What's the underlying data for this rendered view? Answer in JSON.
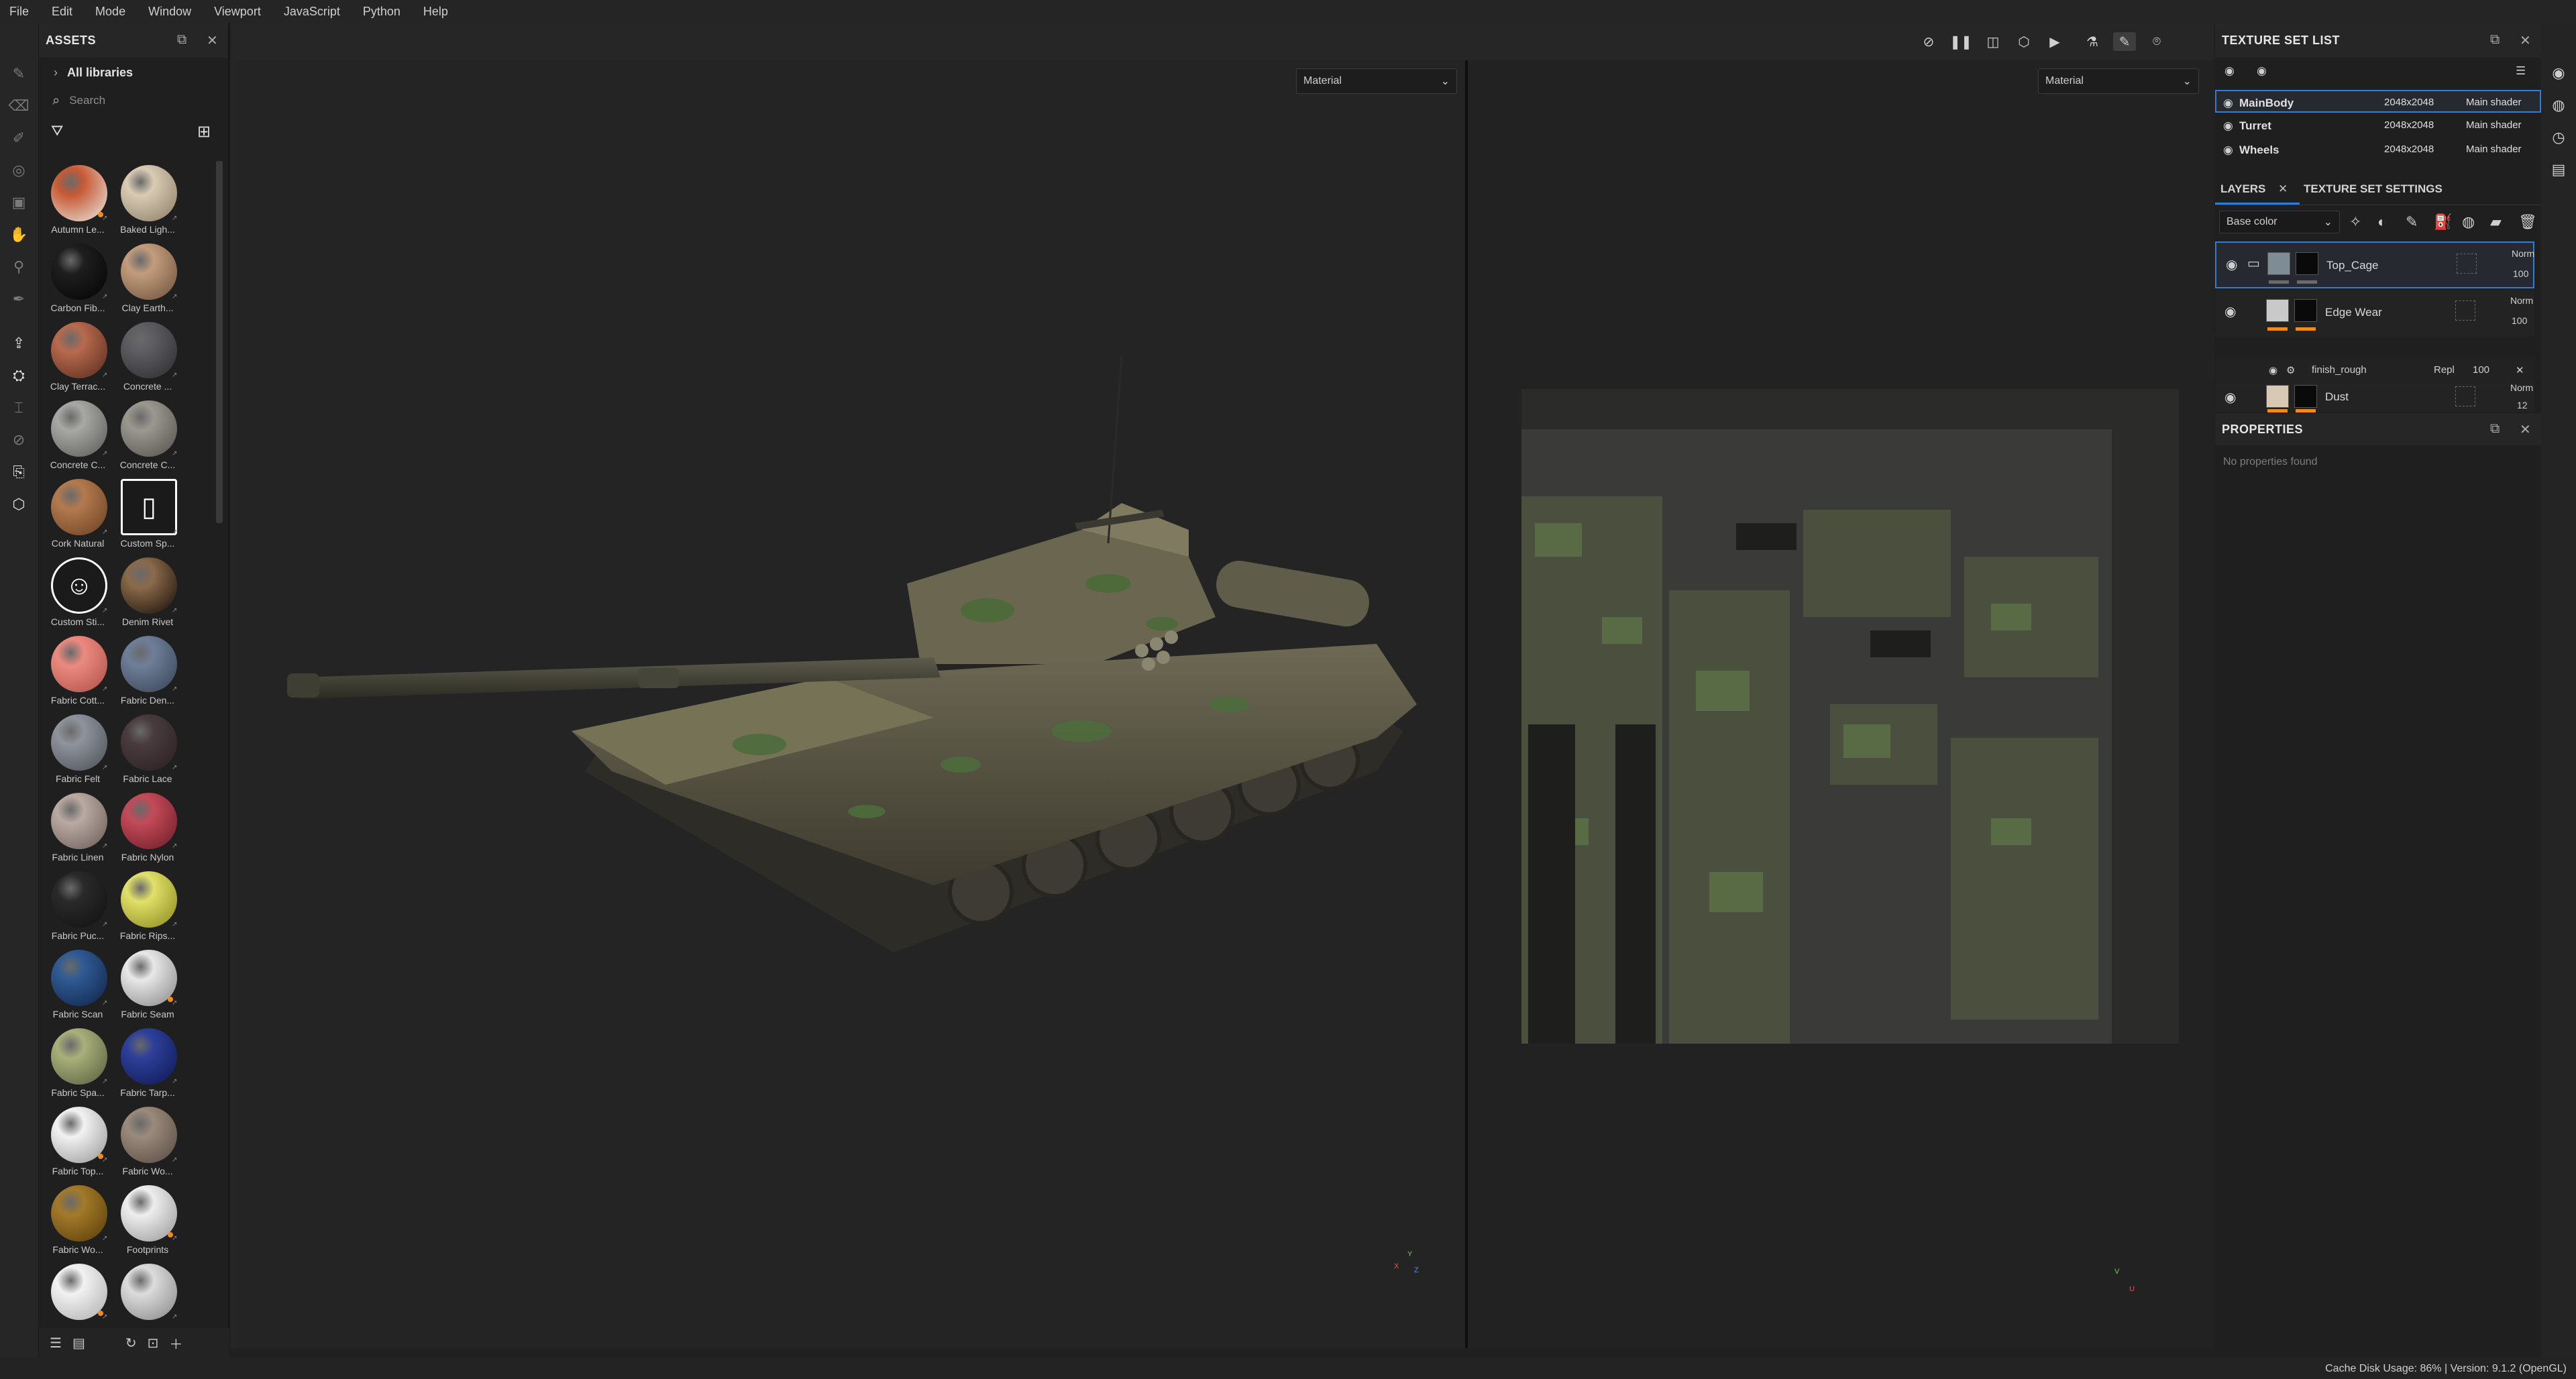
{
  "menu": [
    "File",
    "Edit",
    "Mode",
    "Window",
    "Viewport",
    "JavaScript",
    "Python",
    "Help"
  ],
  "assets": {
    "title": "ASSETS",
    "library": "All libraries",
    "search_placeholder": "Search",
    "items": [
      {
        "label": "Autumn Le...",
        "icon": "leaf-material",
        "colors": [
          "#c65a35",
          "#e9e3dc"
        ],
        "badge": true
      },
      {
        "label": "Baked Ligh...",
        "icon": "material-ball",
        "colors": [
          "#d9cbb4",
          "#8f7f69"
        ]
      },
      {
        "label": "Carbon Fib...",
        "icon": "material-ball",
        "colors": [
          "#1e1e1e",
          "#050505"
        ]
      },
      {
        "label": "Clay Earth...",
        "icon": "material-ball",
        "colors": [
          "#c29d7c",
          "#6f533f"
        ]
      },
      {
        "label": "Clay Terrac...",
        "icon": "material-ball",
        "colors": [
          "#b86a4e",
          "#5a2d1f"
        ]
      },
      {
        "label": "Concrete ...",
        "icon": "material-ball",
        "colors": [
          "#5d5d62",
          "#2e2e32"
        ]
      },
      {
        "label": "Concrete C...",
        "icon": "material-ball",
        "colors": [
          "#a8a8a5",
          "#5c5c5a"
        ]
      },
      {
        "label": "Concrete C...",
        "icon": "material-ball",
        "colors": [
          "#9b9890",
          "#55534e"
        ]
      },
      {
        "label": "Cork Natural",
        "icon": "material-ball",
        "colors": [
          "#b47a4e",
          "#6c4223"
        ]
      },
      {
        "label": "Custom Sp...",
        "icon": "spray-icon",
        "colors": [
          "#ffffff",
          "#ffffff"
        ]
      },
      {
        "label": "Custom Sti...",
        "icon": "sticker-icon",
        "colors": [
          "#ffffff",
          "#ffffff"
        ]
      },
      {
        "label": "Denim Rivet",
        "icon": "material-ball",
        "colors": [
          "#8a6a4a",
          "#1b120b"
        ]
      },
      {
        "label": "Fabric Cott...",
        "icon": "material-ball",
        "colors": [
          "#eb8a80",
          "#b0524a"
        ]
      },
      {
        "label": "Fabric Den...",
        "icon": "material-ball",
        "colors": [
          "#6f7f99",
          "#3a4556"
        ]
      },
      {
        "label": "Fabric Felt",
        "icon": "material-ball",
        "colors": [
          "#8f949c",
          "#4d5158"
        ]
      },
      {
        "label": "Fabric Lace",
        "icon": "material-ball",
        "colors": [
          "#4a3c3e",
          "#2a2022"
        ]
      },
      {
        "label": "Fabric Linen",
        "icon": "material-ball",
        "colors": [
          "#b9aaa3",
          "#6d5f59"
        ]
      },
      {
        "label": "Fabric Nylon",
        "icon": "material-ball",
        "colors": [
          "#c44a58",
          "#6d1e29"
        ]
      },
      {
        "label": "Fabric Puc...",
        "icon": "material-ball",
        "colors": [
          "#2a2a2a",
          "#111111"
        ]
      },
      {
        "label": "Fabric Rips...",
        "icon": "material-ball",
        "colors": [
          "#e0e06a",
          "#8d8c1e"
        ]
      },
      {
        "label": "Fabric Scan",
        "icon": "material-ball",
        "colors": [
          "#2f5a93",
          "#12254a"
        ]
      },
      {
        "label": "Fabric Seam",
        "icon": "material-ball",
        "colors": [
          "#e8e8e8",
          "#8a8a8a"
        ],
        "badge": true
      },
      {
        "label": "Fabric Spa...",
        "icon": "material-ball",
        "colors": [
          "#a9b07a",
          "#5a6040"
        ]
      },
      {
        "label": "Fabric Tarp...",
        "icon": "material-ball",
        "colors": [
          "#2d3f9a",
          "#101a55"
        ]
      },
      {
        "label": "Fabric Top...",
        "icon": "material-ball",
        "colors": [
          "#f2f2f2",
          "#9a9a9a"
        ],
        "badge": true
      },
      {
        "label": "Fabric Wo...",
        "icon": "material-ball",
        "colors": [
          "#9a8a7c",
          "#5a4d44"
        ]
      },
      {
        "label": "Fabric Wo...",
        "icon": "material-ball",
        "colors": [
          "#a37a2a",
          "#5a3f0a"
        ]
      },
      {
        "label": "Footprints",
        "icon": "material-ball",
        "colors": [
          "#eeeeee",
          "#9a9a9a"
        ],
        "badge": true
      },
      {
        "label": "",
        "icon": "material-ball",
        "colors": [
          "#f2f2f2",
          "#b0b0b0"
        ],
        "badge": true
      },
      {
        "label": "",
        "icon": "material-ball",
        "colors": [
          "#dcdcdc",
          "#8a8a8a"
        ]
      }
    ]
  },
  "viewport": {
    "left_mode": "Material",
    "right_mode": "Material",
    "axis_3d": [
      "Y",
      "X",
      "Z"
    ],
    "axis_2d": [
      "V",
      "U"
    ]
  },
  "texture_set_list": {
    "title": "TEXTURE SET LIST",
    "rows": [
      {
        "name": "MainBody",
        "size": "2048x2048",
        "shader": "Main shader",
        "selected": true
      },
      {
        "name": "Turret",
        "size": "2048x2048",
        "shader": "Main shader",
        "selected": false
      },
      {
        "name": "Wheels",
        "size": "2048x2048",
        "shader": "Main shader",
        "selected": false
      }
    ]
  },
  "layers_panel": {
    "tab_layers": "LAYERS",
    "tab_settings": "TEXTURE SET SETTINGS",
    "channel": "Base color",
    "layers": [
      {
        "name": "Top_Cage",
        "blend": "Norm",
        "opacity": "100",
        "selected": true,
        "folder": true
      },
      {
        "name": "Edge Wear",
        "blend": "Norm",
        "opacity": "100",
        "selected": false,
        "folder": false
      },
      {
        "name": "Dust",
        "blend": "Norm",
        "opacity": "12",
        "selected": false,
        "folder": false
      }
    ],
    "effect": {
      "name": "finish_rough",
      "blend": "Repl",
      "opacity": "100"
    }
  },
  "properties": {
    "title": "PROPERTIES",
    "empty_text": "No properties found"
  },
  "status": {
    "text": "Cache Disk Usage:   86% | Version: 9.1.2 (OpenGL)"
  }
}
